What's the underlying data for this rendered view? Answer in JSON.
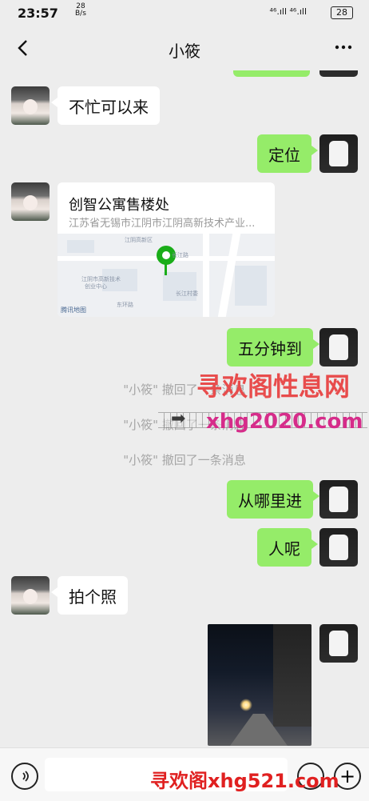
{
  "status": {
    "time": "23:57",
    "net_rate_value": "28",
    "net_rate_unit": "B/s",
    "signal_text": "⁴⁶.ıll ⁴⁶.ıll",
    "battery": "28"
  },
  "header": {
    "title": "小筱",
    "back_icon": "back-chevron-icon",
    "more_icon": "more-dots-icon"
  },
  "messages": [
    {
      "side": "left",
      "text": "不忙可以来"
    },
    {
      "side": "right",
      "text": "定位"
    },
    {
      "side": "left",
      "type": "location",
      "title": "创智公寓售楼处",
      "address": "江苏省无锡市江阴市江阴高新技术产业..."
    },
    {
      "side": "right",
      "text": "五分钟到"
    },
    {
      "side": "system",
      "text": "\"小筱\" 撤回了一条消息"
    },
    {
      "side": "system",
      "text": "\"小筱\" 撤回了一条消息"
    },
    {
      "side": "system",
      "text": "\"小筱\" 撤回了一条消息"
    },
    {
      "side": "right",
      "text": "从哪里进"
    },
    {
      "side": "right",
      "text": "人呢"
    },
    {
      "side": "left",
      "text": "拍个照"
    },
    {
      "side": "right",
      "type": "image"
    }
  ],
  "map_labels": [
    "江阴高新区",
    "江阴市高新技术",
    "创业中心",
    "长江路",
    "东环路",
    "长江村委",
    "腾讯地图"
  ],
  "watermarks": {
    "top": "寻欢阁性息网",
    "url": "xhg2020.com",
    "bottom": "寻欢阁xhg521.com"
  },
  "colors": {
    "background": "#ededed",
    "bubble_right": "#95ec69",
    "bubble_left": "#ffffff",
    "pin": "#1aad19"
  }
}
